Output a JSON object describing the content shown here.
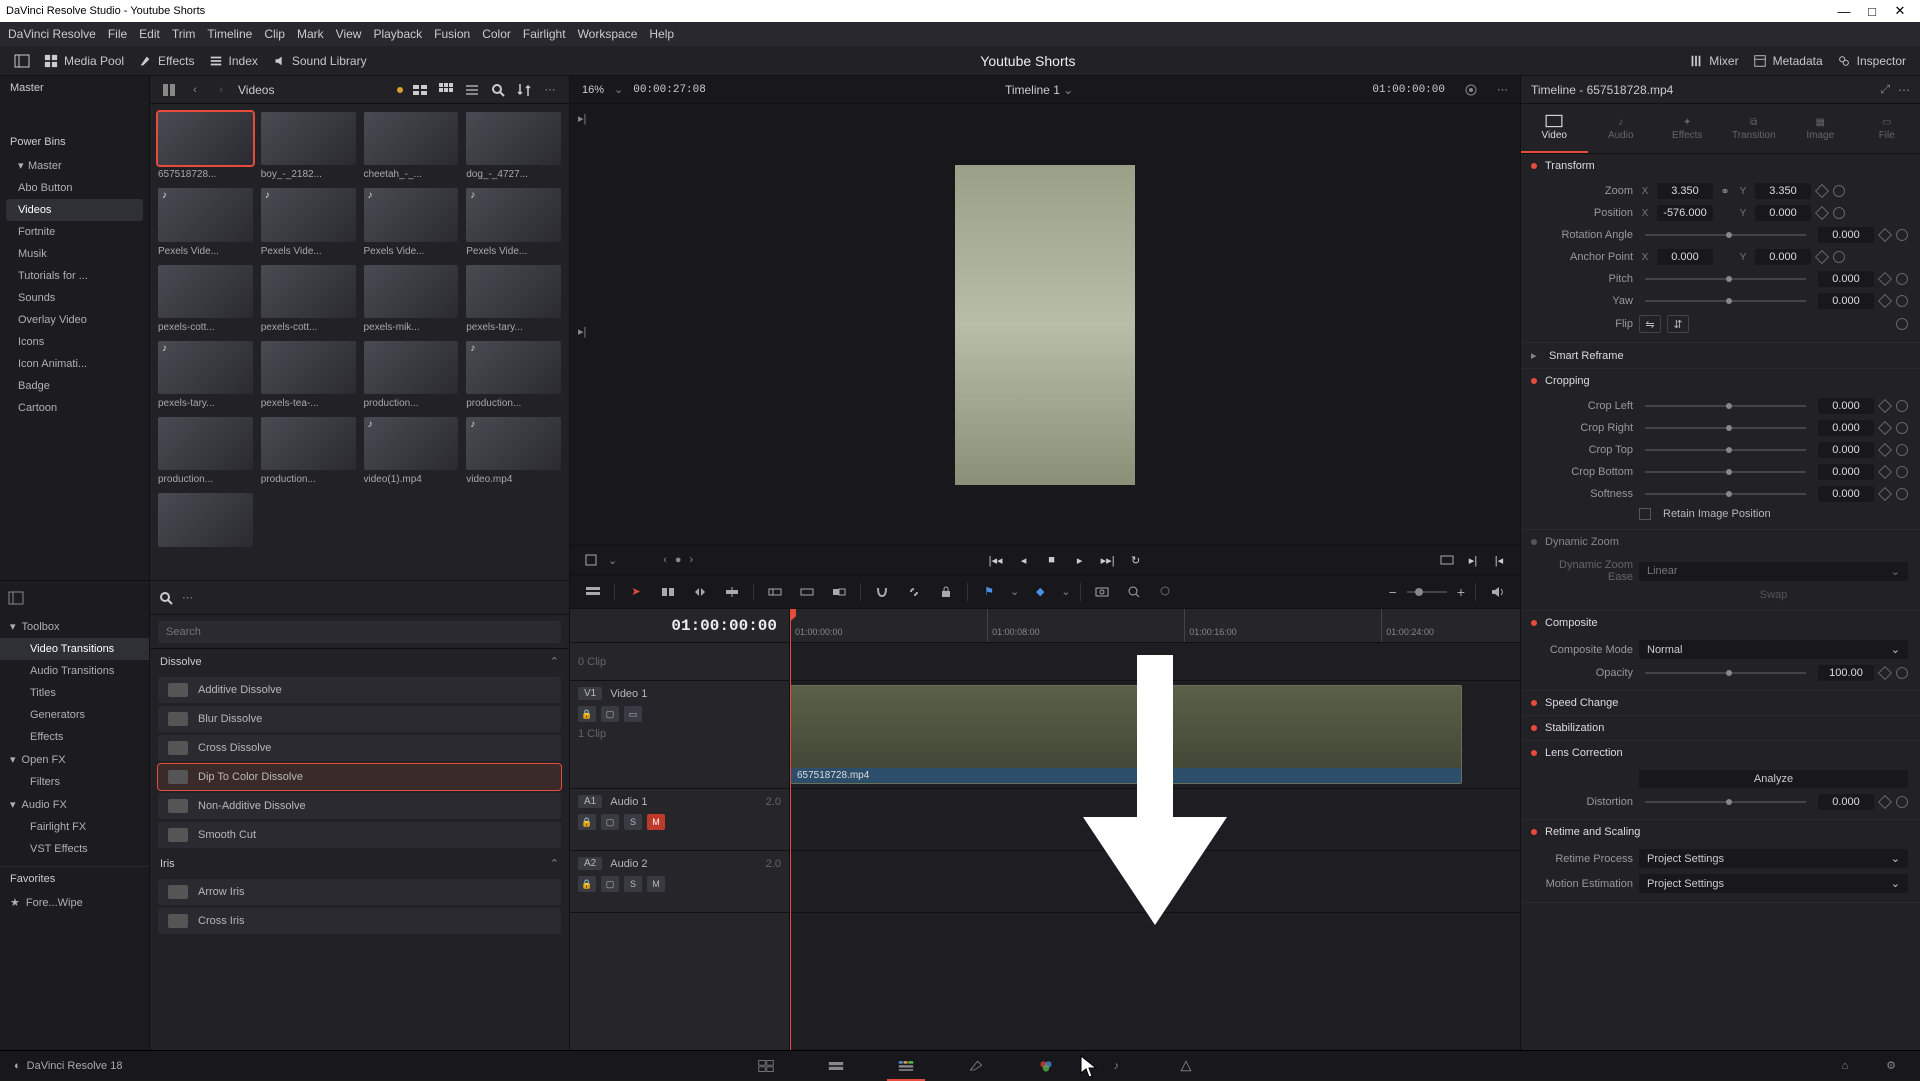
{
  "app": {
    "title": "DaVinci Resolve Studio - Youtube Shorts",
    "version": "DaVinci Resolve 18"
  },
  "menu": [
    "DaVinci Resolve",
    "File",
    "Edit",
    "Trim",
    "Timeline",
    "Clip",
    "Mark",
    "View",
    "Playback",
    "Fusion",
    "Color",
    "Fairlight",
    "Workspace",
    "Help"
  ],
  "toptool": {
    "media_pool": "Media Pool",
    "effects": "Effects",
    "index": "Index",
    "sound_lib": "Sound Library",
    "mixer": "Mixer",
    "metadata": "Metadata",
    "inspector": "Inspector",
    "project": "Youtube Shorts"
  },
  "bins": {
    "master": "Master",
    "power_bins": "Power Bins",
    "master2": "Master",
    "items": [
      "Abo Button",
      "Videos",
      "Fortnite",
      "Musik",
      "Tutorials for ...",
      "Sounds",
      "Overlay Video",
      "Icons",
      "Icon Animati...",
      "Badge",
      "Cartoon"
    ]
  },
  "mediagrid": {
    "title": "Videos",
    "back": "‹",
    "fwd": "›",
    "clips": [
      {
        "n": "657518728...",
        "sel": true
      },
      {
        "n": "boy_-_2182..."
      },
      {
        "n": "cheetah_-_..."
      },
      {
        "n": "dog_-_4727..."
      },
      {
        "n": "Pexels Vide...",
        "a": true
      },
      {
        "n": "Pexels Vide...",
        "a": true
      },
      {
        "n": "Pexels Vide...",
        "a": true
      },
      {
        "n": "Pexels Vide...",
        "a": true
      },
      {
        "n": "pexels-cott..."
      },
      {
        "n": "pexels-cott..."
      },
      {
        "n": "pexels-mik..."
      },
      {
        "n": "pexels-tary..."
      },
      {
        "n": "pexels-tary...",
        "a": true
      },
      {
        "n": "pexels-tea-..."
      },
      {
        "n": "production..."
      },
      {
        "n": "production...",
        "a": true
      },
      {
        "n": "production..."
      },
      {
        "n": "production..."
      },
      {
        "n": "video(1).mp4",
        "a": true
      },
      {
        "n": "video.mp4",
        "a": true
      },
      {
        "n": ""
      }
    ]
  },
  "fx": {
    "search_placeholder": "Search",
    "tree": [
      {
        "n": "Toolbox",
        "exp": true
      },
      {
        "n": "Video Transitions",
        "sel": true,
        "indent": 1
      },
      {
        "n": "Audio Transitions",
        "indent": 1
      },
      {
        "n": "Titles",
        "indent": 1
      },
      {
        "n": "Generators",
        "indent": 1
      },
      {
        "n": "Effects",
        "indent": 1
      },
      {
        "n": "Open FX",
        "exp": true
      },
      {
        "n": "Filters",
        "indent": 1
      },
      {
        "n": "Audio FX",
        "exp": true
      },
      {
        "n": "Fairlight FX",
        "indent": 1
      },
      {
        "n": "VST Effects",
        "indent": 1
      }
    ],
    "favorites": "Favorites",
    "fav_items": [
      "Fore...Wipe"
    ],
    "cats": [
      {
        "n": "Dissolve",
        "items": [
          "Additive Dissolve",
          "Blur Dissolve",
          "Cross Dissolve",
          "Dip To Color Dissolve",
          "Non-Additive Dissolve",
          "Smooth Cut"
        ],
        "sel": "Dip To Color Dissolve"
      },
      {
        "n": "Iris",
        "items": [
          "Arrow Iris",
          "Cross Iris"
        ]
      }
    ]
  },
  "viewer": {
    "zoom": "16%",
    "tc_src": "00:00:27:08",
    "timeline_name": "Timeline 1",
    "tc_rec": "01:00:00:00"
  },
  "timeline": {
    "tc": "01:00:00:00",
    "ticks": [
      "01:00:00:00",
      "01:00:08:00",
      "01:00:16:00",
      "01:00:24:00"
    ],
    "gap_label": "0 Clip",
    "v1": {
      "tag": "V1",
      "name": "Video 1",
      "count": "1 Clip",
      "clip": "657518728.mp4"
    },
    "a1": {
      "tag": "A1",
      "name": "Audio 1",
      "meter": "2.0"
    },
    "a2": {
      "tag": "A2",
      "name": "Audio 2",
      "meter": "2.0"
    }
  },
  "inspector": {
    "title": "Timeline - 657518728.mp4",
    "tabs": [
      "Video",
      "Audio",
      "Effects",
      "Transition",
      "Image",
      "File"
    ],
    "transform": {
      "title": "Transform",
      "zoom": "Zoom",
      "zoom_x": "3.350",
      "zoom_y": "3.350",
      "position": "Position",
      "pos_x": "-576.000",
      "pos_y": "0.000",
      "rotation": "Rotation Angle",
      "rotation_v": "0.000",
      "anchor": "Anchor Point",
      "anchor_x": "0.000",
      "anchor_y": "0.000",
      "pitch": "Pitch",
      "pitch_v": "0.000",
      "yaw": "Yaw",
      "yaw_v": "0.000",
      "flip": "Flip"
    },
    "smart_reframe": "Smart Reframe",
    "cropping": {
      "title": "Cropping",
      "left": "Crop Left",
      "left_v": "0.000",
      "right": "Crop Right",
      "right_v": "0.000",
      "top": "Crop Top",
      "top_v": "0.000",
      "bottom": "Crop Bottom",
      "bottom_v": "0.000",
      "soft": "Softness",
      "soft_v": "0.000",
      "retain": "Retain Image Position"
    },
    "dynamic_zoom": {
      "title": "Dynamic Zoom",
      "ease": "Dynamic Zoom Ease",
      "ease_v": "Linear",
      "swap": "Swap"
    },
    "composite": {
      "title": "Composite",
      "mode": "Composite Mode",
      "mode_v": "Normal",
      "opacity": "Opacity",
      "opacity_v": "100.00"
    },
    "speed": "Speed Change",
    "stab": "Stabilization",
    "lens": {
      "title": "Lens Correction",
      "analyze": "Analyze",
      "dist": "Distortion",
      "dist_v": "0.000"
    },
    "retime": {
      "title": "Retime and Scaling",
      "proc": "Retime Process",
      "proc_v": "Project Settings",
      "est": "Motion Estimation",
      "est_v": "Project Settings"
    }
  }
}
